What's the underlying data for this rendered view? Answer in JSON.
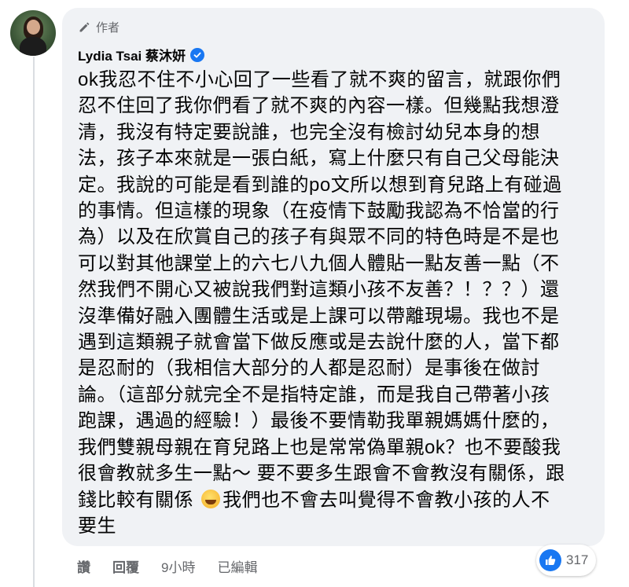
{
  "author_label": "作者",
  "author_name": "Lydia Tsai 蔡沐妍",
  "comment_lines": [
    "ok我忍不住不小心回了一些看了就不爽的留言，就跟你們",
    "忍不住回了我你們看了就不爽的內容一樣。但幾點我想澄",
    "清，我沒有特定要說誰，也完全沒有檢討幼兒本身的想",
    "法，孩子本來就是一張白紙，寫上什麼只有自己父母能決",
    "定。我說的可能是看到誰的po文所以想到育兒路上有碰過",
    "的事情。但這樣的現象（在疫情下鼓勵我認為不恰當的行",
    "為）以及在欣賞自己的孩子有與眾不同的特色時是不是也",
    "可以對其他課堂上的六七八九個人體貼一點友善一點（不",
    "然我們不開心又被說我們對這類小孩不友善？！？？）還",
    "沒準備好融入團體生活或是上課可以帶離現場。我也不是",
    "遇到這類親子就會當下做反應或是去說什麼的人，當下都",
    "是忍耐的（我相信大部分的人都是忍耐）是事後在做討",
    "論。（這部分就完全不是指特定誰，而是我自己帶著小孩",
    "跑課，遇過的經驗！）最後不要情勒我單親媽媽什麼的，",
    "我們雙親母親在育兒路上也是常常偽單親ok？也不要酸我",
    "很會教就多生一點～ 要不要多生跟會不會教沒有關係，跟"
  ],
  "comment_line_17_before": "錢比較有關係 ",
  "comment_line_17_after": "我們也不會去叫覺得不會教小孩的人不",
  "comment_line_18": "要生",
  "actions": {
    "like": "讚",
    "reply": "回覆",
    "time": "9小時",
    "edited": "已編輯"
  },
  "reaction_count": "317",
  "colors": {
    "bubble_bg": "#f0f2f5",
    "secondary_text": "#65676b",
    "accent_blue": "#1877f2"
  },
  "icons": [
    "pencil-icon",
    "verified-badge-icon",
    "laughing-emoji-icon",
    "like-reaction-icon"
  ]
}
